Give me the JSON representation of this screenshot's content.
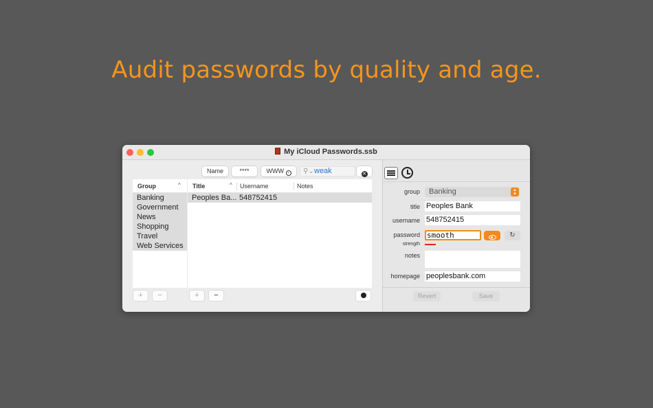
{
  "headline": "Audit passwords by quality and age.",
  "window": {
    "title": "My iCloud Passwords.ssb"
  },
  "toolbar": {
    "name_button": "Name",
    "password_button": "****",
    "www_button": "WWW",
    "search_value": "weak"
  },
  "groups": {
    "header": "Group",
    "items": [
      "Banking",
      "Government",
      "News",
      "Shopping",
      "Travel",
      "Web Services"
    ]
  },
  "items_table": {
    "headers": [
      "Title",
      "Username",
      "Notes"
    ],
    "rows": [
      {
        "title": "Peoples Ba...",
        "username": "548752415",
        "notes": ""
      }
    ]
  },
  "buttons": {
    "add": "+",
    "remove": "−"
  },
  "detail": {
    "labels": {
      "group": "group",
      "title": "title",
      "username": "username",
      "password": "password",
      "strength": "strength",
      "notes": "notes",
      "homepage": "homepage"
    },
    "group_value": "Banking",
    "title_value": "Peoples Bank",
    "username_value": "548752415",
    "password_value": "smooth",
    "notes_value": "",
    "homepage_value": "peoplesbank.com",
    "revert_label": "Revert",
    "save_label": "Save"
  },
  "colors": {
    "accent": "#f5951c",
    "strength_weak": "#e0202a",
    "background": "#585858"
  }
}
